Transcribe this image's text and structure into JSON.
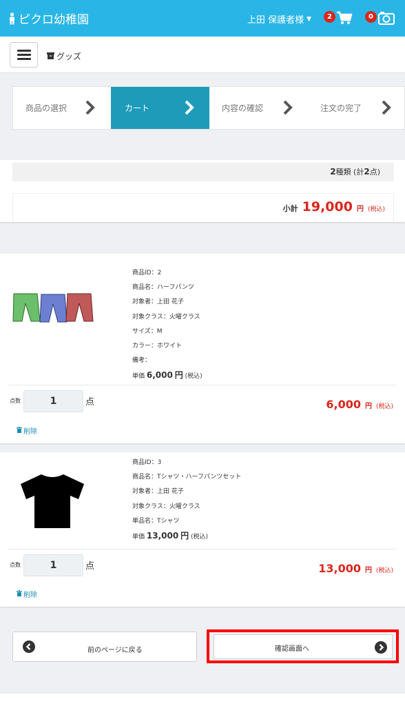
{
  "header": {
    "brand": "ピクロ幼稚園",
    "user": "上田 保護者様",
    "cart_badge": "2",
    "photo_badge": "0",
    "accent_color": "#29b6e6"
  },
  "subnav": {
    "section": "グッズ"
  },
  "steps": [
    {
      "label": "商品の選択",
      "active": false
    },
    {
      "label": "カート",
      "active": true
    },
    {
      "label": "内容の確認",
      "active": false
    },
    {
      "label": "注文の完了",
      "active": false
    }
  ],
  "summary": {
    "kinds": "2",
    "kinds_label": "種類",
    "total_prefix": "(計",
    "total_count": "2",
    "total_suffix": "点)",
    "subtotal_label": "小計",
    "subtotal": "19,000",
    "yen": "円",
    "tax": "(税込)"
  },
  "items": [
    {
      "id": "商品ID：2",
      "name": "商品名：ハーフパンツ",
      "target": "対象者：上田 花子",
      "class": "対象クラス：火曜クラス",
      "size": "サイズ：M",
      "color": "カラー：ホワイト",
      "note": "備考：",
      "unit_price_label": "単価",
      "unit_price": "6,000",
      "unit_yen": "円",
      "unit_tax": "(税込)",
      "qty_label": "点数",
      "qty": "1",
      "qty_unit": "点",
      "line_total": "6,000",
      "yen": "円",
      "tax": "(税込)",
      "delete": "削除",
      "image": "shorts-image"
    },
    {
      "id": "商品ID：3",
      "name": "商品名：Tシャツ・ハーフパンツセット",
      "target": "対象者：上田 花子",
      "class": "対象クラス：火曜クラス",
      "single": "単品名：Tシャツ",
      "unit_price_label": "単価",
      "unit_price": "13,000",
      "unit_yen": "円",
      "unit_tax": "(税込)",
      "qty_label": "点数",
      "qty": "1",
      "qty_unit": "点",
      "line_total": "13,000",
      "yen": "円",
      "tax": "(税込)",
      "delete": "削除",
      "image": "tshirt-image"
    }
  ],
  "buttons": {
    "back": "前のページに戻る",
    "next": "確認画面へ"
  },
  "colors": {
    "price_red": "#d9261c",
    "step_active": "#1e9bb8",
    "highlight": "#ff0000"
  }
}
